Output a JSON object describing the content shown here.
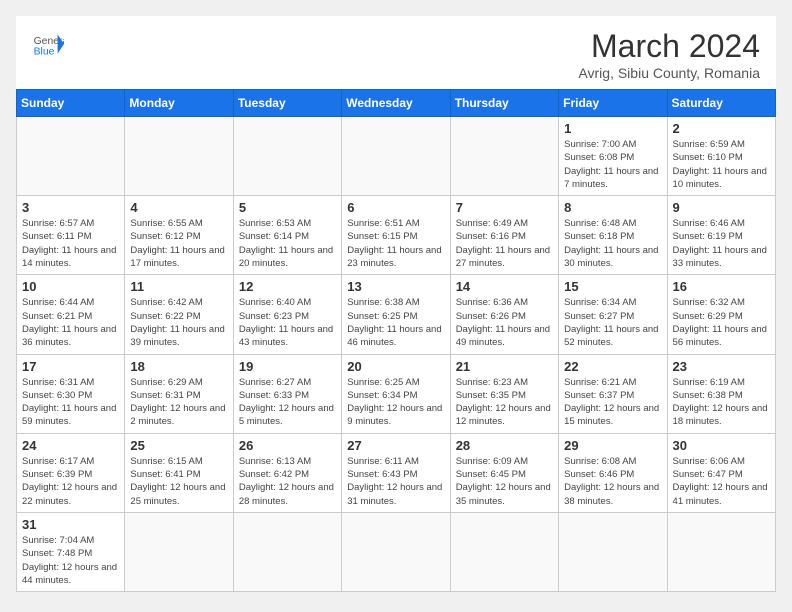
{
  "header": {
    "logo_general": "General",
    "logo_blue": "Blue",
    "month_year": "March 2024",
    "location": "Avrig, Sibiu County, Romania"
  },
  "days_of_week": [
    "Sunday",
    "Monday",
    "Tuesday",
    "Wednesday",
    "Thursday",
    "Friday",
    "Saturday"
  ],
  "weeks": [
    [
      {
        "day": "",
        "info": ""
      },
      {
        "day": "",
        "info": ""
      },
      {
        "day": "",
        "info": ""
      },
      {
        "day": "",
        "info": ""
      },
      {
        "day": "",
        "info": ""
      },
      {
        "day": "1",
        "info": "Sunrise: 7:00 AM\nSunset: 6:08 PM\nDaylight: 11 hours and 7 minutes."
      },
      {
        "day": "2",
        "info": "Sunrise: 6:59 AM\nSunset: 6:10 PM\nDaylight: 11 hours and 10 minutes."
      }
    ],
    [
      {
        "day": "3",
        "info": "Sunrise: 6:57 AM\nSunset: 6:11 PM\nDaylight: 11 hours and 14 minutes."
      },
      {
        "day": "4",
        "info": "Sunrise: 6:55 AM\nSunset: 6:12 PM\nDaylight: 11 hours and 17 minutes."
      },
      {
        "day": "5",
        "info": "Sunrise: 6:53 AM\nSunset: 6:14 PM\nDaylight: 11 hours and 20 minutes."
      },
      {
        "day": "6",
        "info": "Sunrise: 6:51 AM\nSunset: 6:15 PM\nDaylight: 11 hours and 23 minutes."
      },
      {
        "day": "7",
        "info": "Sunrise: 6:49 AM\nSunset: 6:16 PM\nDaylight: 11 hours and 27 minutes."
      },
      {
        "day": "8",
        "info": "Sunrise: 6:48 AM\nSunset: 6:18 PM\nDaylight: 11 hours and 30 minutes."
      },
      {
        "day": "9",
        "info": "Sunrise: 6:46 AM\nSunset: 6:19 PM\nDaylight: 11 hours and 33 minutes."
      }
    ],
    [
      {
        "day": "10",
        "info": "Sunrise: 6:44 AM\nSunset: 6:21 PM\nDaylight: 11 hours and 36 minutes."
      },
      {
        "day": "11",
        "info": "Sunrise: 6:42 AM\nSunset: 6:22 PM\nDaylight: 11 hours and 39 minutes."
      },
      {
        "day": "12",
        "info": "Sunrise: 6:40 AM\nSunset: 6:23 PM\nDaylight: 11 hours and 43 minutes."
      },
      {
        "day": "13",
        "info": "Sunrise: 6:38 AM\nSunset: 6:25 PM\nDaylight: 11 hours and 46 minutes."
      },
      {
        "day": "14",
        "info": "Sunrise: 6:36 AM\nSunset: 6:26 PM\nDaylight: 11 hours and 49 minutes."
      },
      {
        "day": "15",
        "info": "Sunrise: 6:34 AM\nSunset: 6:27 PM\nDaylight: 11 hours and 52 minutes."
      },
      {
        "day": "16",
        "info": "Sunrise: 6:32 AM\nSunset: 6:29 PM\nDaylight: 11 hours and 56 minutes."
      }
    ],
    [
      {
        "day": "17",
        "info": "Sunrise: 6:31 AM\nSunset: 6:30 PM\nDaylight: 11 hours and 59 minutes."
      },
      {
        "day": "18",
        "info": "Sunrise: 6:29 AM\nSunset: 6:31 PM\nDaylight: 12 hours and 2 minutes."
      },
      {
        "day": "19",
        "info": "Sunrise: 6:27 AM\nSunset: 6:33 PM\nDaylight: 12 hours and 5 minutes."
      },
      {
        "day": "20",
        "info": "Sunrise: 6:25 AM\nSunset: 6:34 PM\nDaylight: 12 hours and 9 minutes."
      },
      {
        "day": "21",
        "info": "Sunrise: 6:23 AM\nSunset: 6:35 PM\nDaylight: 12 hours and 12 minutes."
      },
      {
        "day": "22",
        "info": "Sunrise: 6:21 AM\nSunset: 6:37 PM\nDaylight: 12 hours and 15 minutes."
      },
      {
        "day": "23",
        "info": "Sunrise: 6:19 AM\nSunset: 6:38 PM\nDaylight: 12 hours and 18 minutes."
      }
    ],
    [
      {
        "day": "24",
        "info": "Sunrise: 6:17 AM\nSunset: 6:39 PM\nDaylight: 12 hours and 22 minutes."
      },
      {
        "day": "25",
        "info": "Sunrise: 6:15 AM\nSunset: 6:41 PM\nDaylight: 12 hours and 25 minutes."
      },
      {
        "day": "26",
        "info": "Sunrise: 6:13 AM\nSunset: 6:42 PM\nDaylight: 12 hours and 28 minutes."
      },
      {
        "day": "27",
        "info": "Sunrise: 6:11 AM\nSunset: 6:43 PM\nDaylight: 12 hours and 31 minutes."
      },
      {
        "day": "28",
        "info": "Sunrise: 6:09 AM\nSunset: 6:45 PM\nDaylight: 12 hours and 35 minutes."
      },
      {
        "day": "29",
        "info": "Sunrise: 6:08 AM\nSunset: 6:46 PM\nDaylight: 12 hours and 38 minutes."
      },
      {
        "day": "30",
        "info": "Sunrise: 6:06 AM\nSunset: 6:47 PM\nDaylight: 12 hours and 41 minutes."
      }
    ],
    [
      {
        "day": "31",
        "info": "Sunrise: 7:04 AM\nSunset: 7:48 PM\nDaylight: 12 hours and 44 minutes."
      },
      {
        "day": "",
        "info": ""
      },
      {
        "day": "",
        "info": ""
      },
      {
        "day": "",
        "info": ""
      },
      {
        "day": "",
        "info": ""
      },
      {
        "day": "",
        "info": ""
      },
      {
        "day": "",
        "info": ""
      }
    ]
  ]
}
